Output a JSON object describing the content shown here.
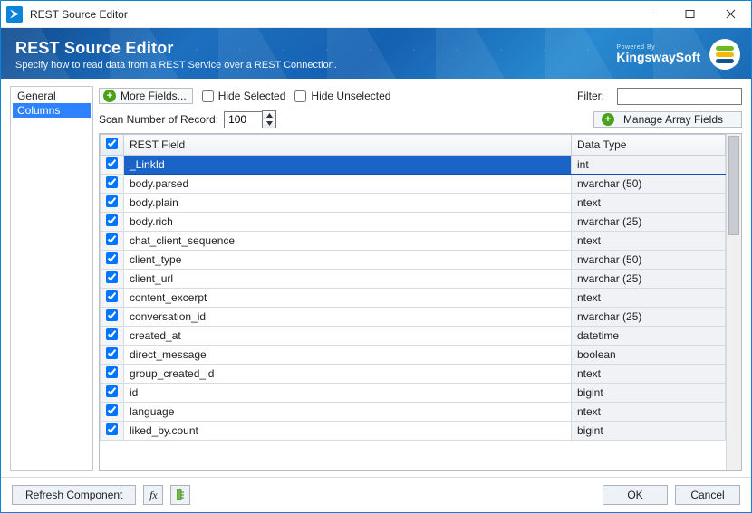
{
  "window": {
    "title": "REST Source Editor"
  },
  "banner": {
    "title": "REST Source Editor",
    "subtitle": "Specify how to read data from a REST Service over a REST Connection.",
    "powered_by": "Powered By",
    "brand_name": "KingswaySoft"
  },
  "nav": {
    "general": "General",
    "columns": "Columns",
    "active": "columns"
  },
  "toolbar": {
    "more_fields": "More Fields...",
    "hide_selected": "Hide Selected",
    "hide_unselected": "Hide Unselected",
    "filter_label": "Filter:",
    "filter_value": ""
  },
  "toolbar2": {
    "scan_label": "Scan Number of Record:",
    "scan_value": "100",
    "manage_array": "Manage Array Fields"
  },
  "table": {
    "header_field": "REST Field",
    "header_type": "Data Type",
    "rows": [
      {
        "checked": true,
        "field": "_LinkId",
        "type": "int",
        "selected": true
      },
      {
        "checked": true,
        "field": "body.parsed",
        "type": "nvarchar (50)",
        "selected": false
      },
      {
        "checked": true,
        "field": "body.plain",
        "type": "ntext",
        "selected": false
      },
      {
        "checked": true,
        "field": "body.rich",
        "type": "nvarchar (25)",
        "selected": false
      },
      {
        "checked": true,
        "field": "chat_client_sequence",
        "type": "ntext",
        "selected": false
      },
      {
        "checked": true,
        "field": "client_type",
        "type": "nvarchar (50)",
        "selected": false
      },
      {
        "checked": true,
        "field": "client_url",
        "type": "nvarchar (25)",
        "selected": false
      },
      {
        "checked": true,
        "field": "content_excerpt",
        "type": "ntext",
        "selected": false
      },
      {
        "checked": true,
        "field": "conversation_id",
        "type": "nvarchar (25)",
        "selected": false
      },
      {
        "checked": true,
        "field": "created_at",
        "type": "datetime",
        "selected": false
      },
      {
        "checked": true,
        "field": "direct_message",
        "type": "boolean",
        "selected": false
      },
      {
        "checked": true,
        "field": "group_created_id",
        "type": "ntext",
        "selected": false
      },
      {
        "checked": true,
        "field": "id",
        "type": "bigint",
        "selected": false
      },
      {
        "checked": true,
        "field": "language",
        "type": "ntext",
        "selected": false
      },
      {
        "checked": true,
        "field": "liked_by.count",
        "type": "bigint",
        "selected": false
      }
    ]
  },
  "footer": {
    "refresh": "Refresh Component",
    "ok": "OK",
    "cancel": "Cancel"
  }
}
